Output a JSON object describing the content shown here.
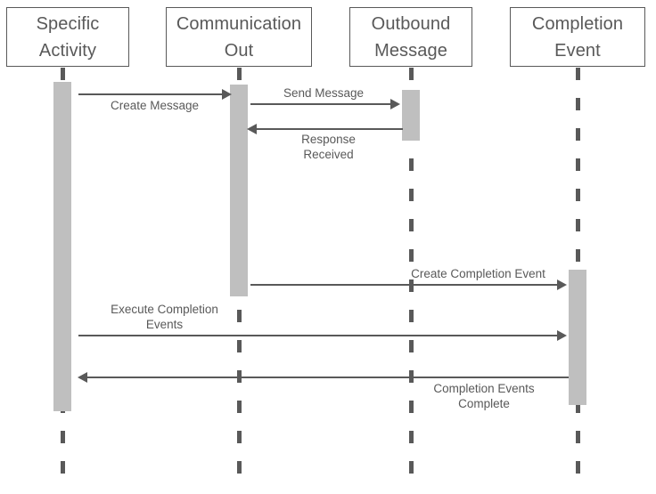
{
  "diagram": {
    "type": "sequence-diagram",
    "title": "",
    "colors": {
      "stroke": "#595959",
      "activation_fill": "#BFBFBF",
      "background": "#FFFFFF",
      "text": "#595959"
    }
  },
  "lifelines": [
    {
      "id": "specific-activity",
      "label": "Specific\nActivity"
    },
    {
      "id": "communication-out",
      "label": "Communication\nOut"
    },
    {
      "id": "outbound-message",
      "label": "Outbound\nMessage"
    },
    {
      "id": "completion-event",
      "label": "Completion\nEvent"
    }
  ],
  "messages": [
    {
      "id": "create-message",
      "label": "Create Message",
      "from": "specific-activity",
      "to": "communication-out",
      "direction": "right"
    },
    {
      "id": "send-message",
      "label": "Send Message",
      "from": "communication-out",
      "to": "outbound-message",
      "direction": "right"
    },
    {
      "id": "response-received",
      "label": "Response\nReceived",
      "from": "outbound-message",
      "to": "communication-out",
      "direction": "left"
    },
    {
      "id": "create-completion-event",
      "label": "Create Completion Event",
      "from": "communication-out",
      "to": "completion-event",
      "direction": "right"
    },
    {
      "id": "execute-completion-events",
      "label": "Execute Completion\nEvents",
      "from": "specific-activity",
      "to": "completion-event",
      "direction": "right"
    },
    {
      "id": "completion-events-complete",
      "label": "Completion Events\nComplete",
      "from": "completion-event",
      "to": "specific-activity",
      "direction": "left"
    }
  ]
}
